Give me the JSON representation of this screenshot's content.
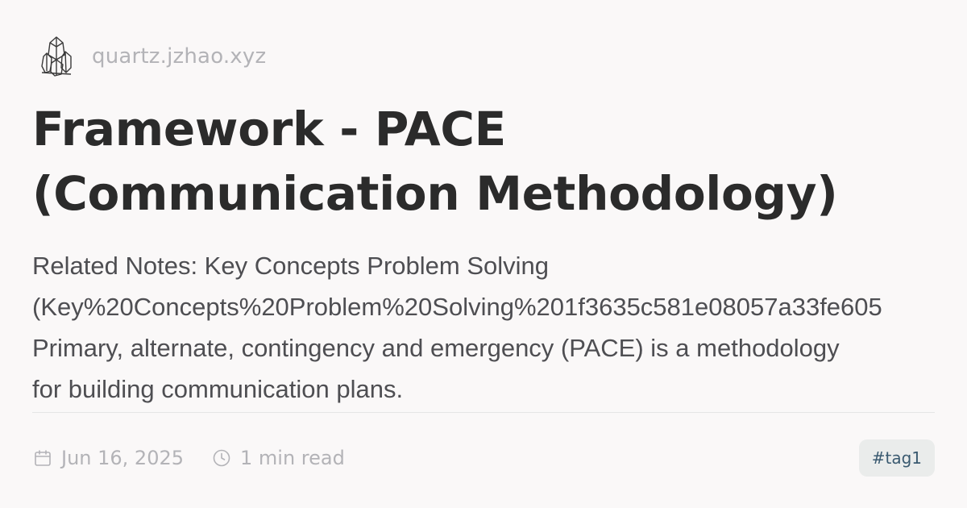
{
  "site": {
    "logo_icon": "crystal-logo-icon",
    "url": "quartz.jzhao.xyz"
  },
  "article": {
    "title_lines": [
      "Framework - PACE",
      "(Communication Methodology)"
    ],
    "excerpt_lines": [
      "Related Notes: Key Concepts Problem Solving",
      "(Key%20Concepts%20Problem%20Solving%201f3635c581e08057a33fe605",
      "Primary, alternate, contingency and emergency (PACE) is a methodology",
      "for building communication plans."
    ]
  },
  "meta": {
    "date_icon": "calendar-icon",
    "date": "Jun 16, 2025",
    "read_icon": "clock-icon",
    "read_time": "1 min read"
  },
  "tags": [
    "#tag1"
  ],
  "colors": {
    "background": "#faf8f8",
    "title": "#2b2b2b",
    "body_text": "#4e4e52",
    "muted": "#b3b3b7",
    "tag_bg": "#eaeceb",
    "tag_text": "#3a5a70"
  }
}
